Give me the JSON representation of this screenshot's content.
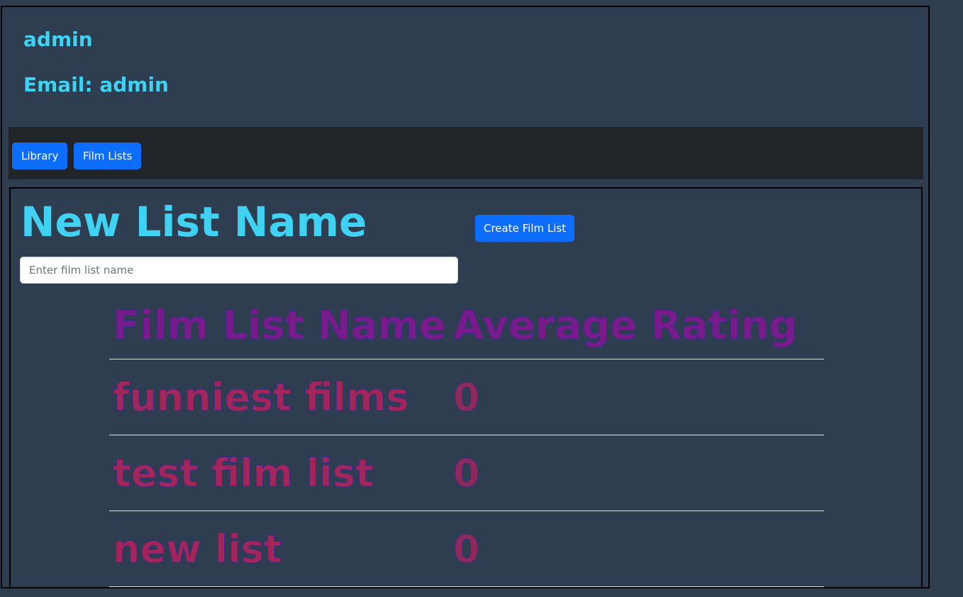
{
  "user": {
    "name": "admin",
    "email": "Email: admin"
  },
  "nav": {
    "library_label": "Library",
    "film_lists_label": "Film Lists"
  },
  "create": {
    "title": "New List Name",
    "input_placeholder": "Enter film list name",
    "button_label": "Create Film List"
  },
  "table": {
    "headers": [
      "Film List Name",
      "Average Rating"
    ],
    "rows": [
      {
        "name": "funniest films",
        "rating": "0"
      },
      {
        "name": "test film list",
        "rating": "0"
      },
      {
        "name": "new list",
        "rating": "0"
      }
    ]
  },
  "colors": {
    "background": "#2e3d50",
    "accent_text": "#3fd2f2",
    "navbar": "#212529",
    "primary_button": "#0d6efd",
    "table_header": "#7a1b8c",
    "table_cell": "#a3265a"
  }
}
